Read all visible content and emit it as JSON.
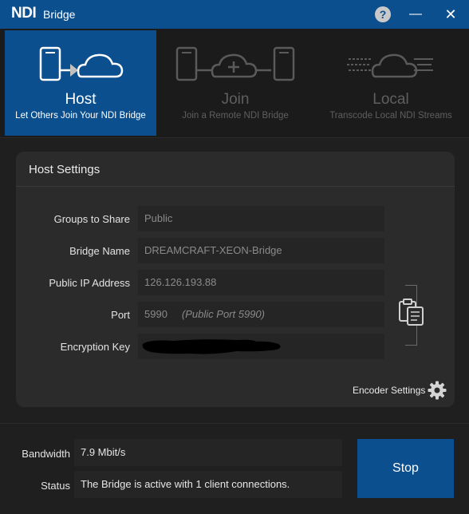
{
  "titlebar": {
    "brand": "NDI",
    "title": "Bridge"
  },
  "modes": [
    {
      "title": "Host",
      "subtitle": "Let Others Join Your NDI Bridge"
    },
    {
      "title": "Join",
      "subtitle": "Join a Remote NDI Bridge"
    },
    {
      "title": "Local",
      "subtitle": "Transcode Local NDI Streams"
    }
  ],
  "settings": {
    "title": "Host Settings",
    "groups_label": "Groups to Share",
    "groups_value": "Public",
    "bridge_name_label": "Bridge Name",
    "bridge_name_value": "DREAMCRAFT-XEON-Bridge",
    "public_ip_label": "Public IP Address",
    "public_ip_value": "126.126.193.88",
    "port_label": "Port",
    "port_value": "5990",
    "port_note": "(Public Port 5990)",
    "encryption_label": "Encryption Key",
    "encoder_settings_label": "Encoder Settings"
  },
  "status": {
    "bandwidth_label": "Bandwidth",
    "bandwidth_value": "7.9 Mbit/s",
    "status_label": "Status",
    "status_value": "The Bridge is active with 1 client connections.",
    "stop_label": "Stop"
  },
  "colors": {
    "accent": "#0b4f8f",
    "background": "#1f1f1f",
    "panel": "#2b2b2b",
    "field": "#252525"
  }
}
